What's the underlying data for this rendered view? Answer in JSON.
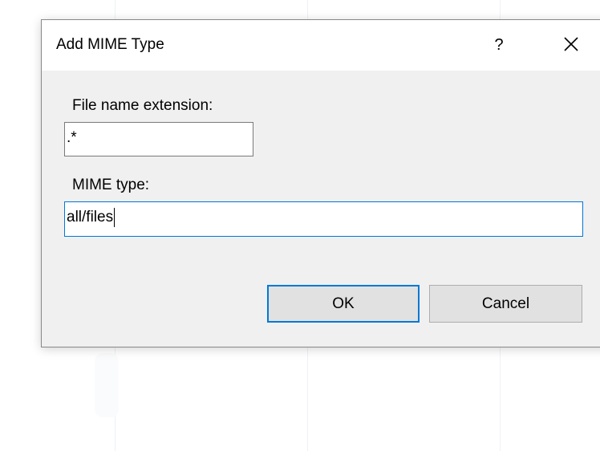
{
  "dialog": {
    "title": "Add MIME Type",
    "help_label": "?",
    "close_icon": "close-icon"
  },
  "form": {
    "extension": {
      "label": "File name extension:",
      "value": ".*"
    },
    "mime_type": {
      "label": "MIME type:",
      "value": "all/files"
    }
  },
  "buttons": {
    "ok_label": "OK",
    "cancel_label": "Cancel"
  },
  "colors": {
    "focus_accent": "#0078d7",
    "dialog_body": "#f0f0f0",
    "button_face": "#e1e1e1"
  }
}
